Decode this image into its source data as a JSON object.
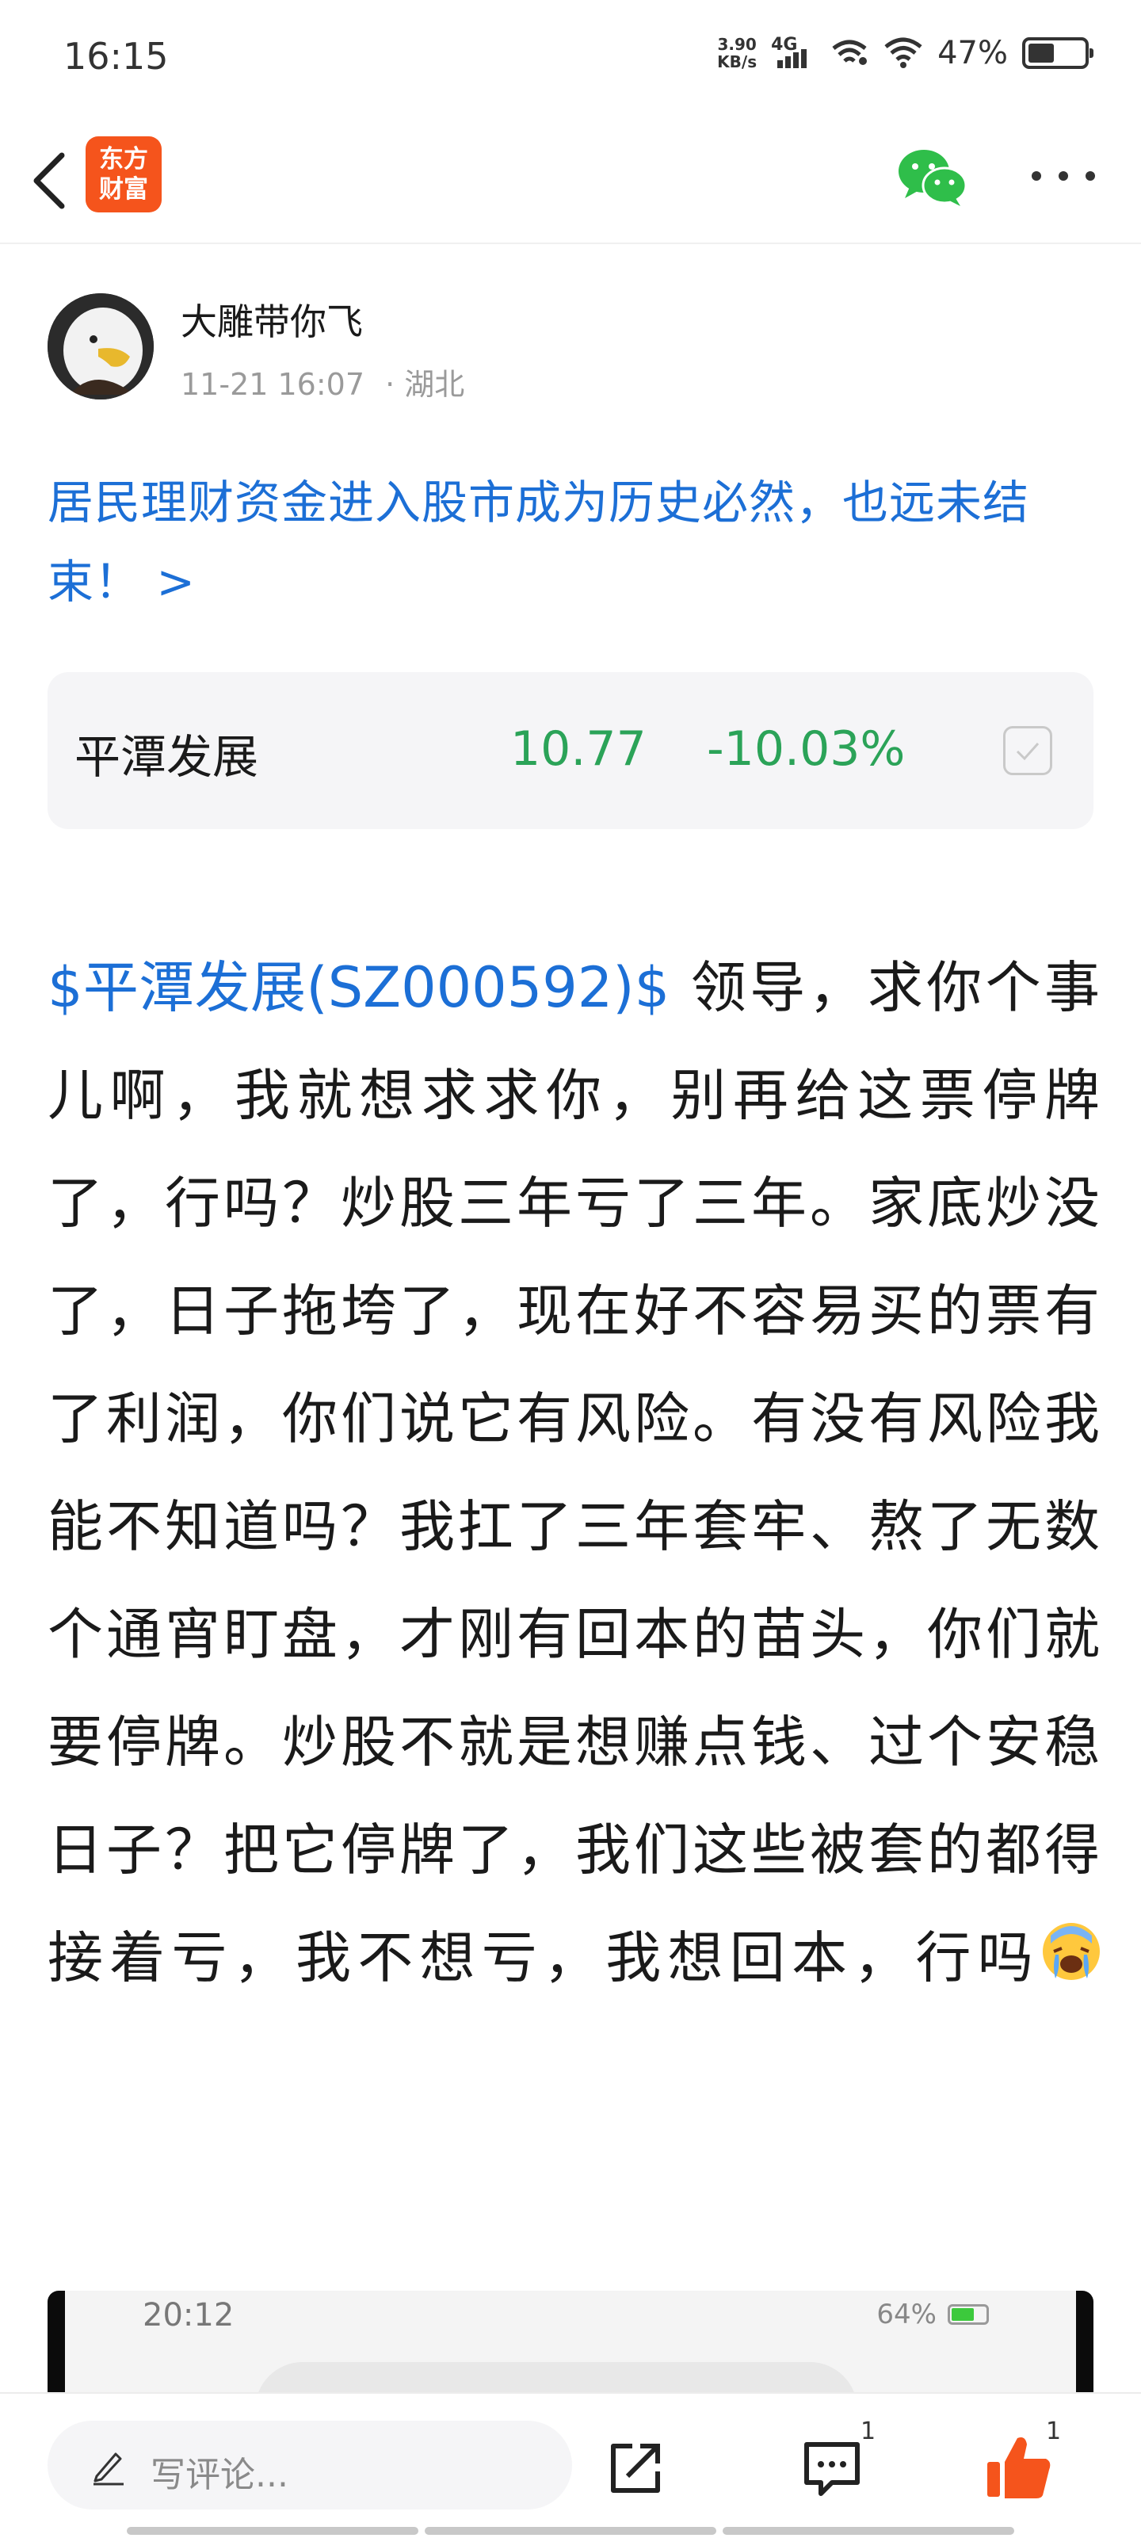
{
  "status_bar": {
    "time": "16:15",
    "net_speed_value": "3.90",
    "net_speed_unit": "KB/s",
    "network": "4G",
    "battery_text": "47%",
    "battery_level": 0.47
  },
  "nav": {
    "logo_line1": "东方",
    "logo_line2": "财富",
    "brand_color": "#f5541c",
    "icons": [
      "back-arrow-icon",
      "wechat-icon",
      "more-icon"
    ]
  },
  "author": {
    "name": "大雕带你飞",
    "timestamp": "11-21 16:07",
    "location": "· 湖北"
  },
  "headline": "居民理财资金进入股市成为历史必然，也远未结束！ >",
  "stock_card": {
    "name": "平潭发展",
    "price": "10.77",
    "change": "-10.03%",
    "price_color": "#2ba358"
  },
  "post": {
    "tag": "$平潭发展(SZ000592)$",
    "body": " 领导，求你个事儿啊，我就想求求你，别再给这票停牌了，行吗？炒股三年亏了三年。家底炒没了，日子拖垮了，现在好不容易买的票有了利润，你们说它有风险。有没有风险我能不知道吗？我扛了三年套牢、熬了无数个通宵盯盘，才刚有回本的苗头，你们就要停牌。炒股不就是想赚点钱、过个安稳日子？把它停牌了，我们这些被套的都得接着亏，我不想亏，我想回本，行吗",
    "emoji": "loudly-crying-face"
  },
  "embed": {
    "time": "20:12",
    "battery_text": "64%"
  },
  "bottom_bar": {
    "comment_placeholder": "写评论...",
    "comment_count": "1",
    "like_count": "1",
    "like_color": "#f5541c"
  }
}
